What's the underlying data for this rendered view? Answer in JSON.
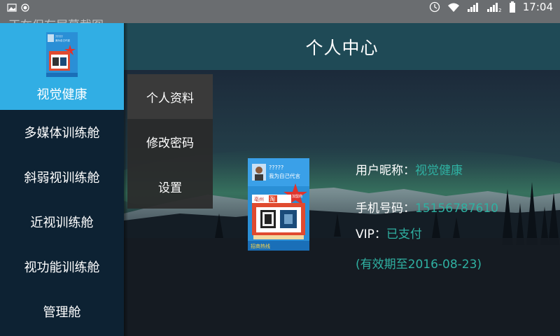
{
  "status_bar": {
    "notification": "正在保存屏幕截图",
    "time": "17:04",
    "sim_index": "2"
  },
  "sidebar": {
    "app_name": "视觉健康",
    "logo_text": {
      "qmarks": "?????",
      "tagline": "我为自己代言",
      "shop": "亳州",
      "tao": "淘",
      "star": "加盟商",
      "footer": "招商热线"
    },
    "items": [
      {
        "label": "多媒体训练舱"
      },
      {
        "label": "斜弱视训练舱"
      },
      {
        "label": "近视训练舱"
      },
      {
        "label": "视功能训练舱"
      },
      {
        "label": "管理舱"
      }
    ]
  },
  "header": {
    "title": "个人中心"
  },
  "submenu": {
    "items": [
      {
        "label": "个人资料"
      },
      {
        "label": "修改密码"
      },
      {
        "label": "设置"
      }
    ]
  },
  "profile": {
    "nickname_label": "用户昵称：",
    "nickname_value": "视觉健康",
    "phone_label": "手机号码：",
    "phone_value": "15156787610",
    "vip_label": "VIP：",
    "vip_value": "已支付",
    "validity": "(有效期至2016-08-23)"
  },
  "colors": {
    "sidebar_accent": "#31aee4",
    "sidebar_bg": "#0d2233",
    "titlebar_bg": "#1f4a56",
    "value_text": "#2fb1a2"
  },
  "icons": {
    "status_left": [
      "image-icon",
      "record-icon"
    ],
    "status_right": [
      "alarm-icon",
      "wifi-icon",
      "signal-icon",
      "signal-icon",
      "battery-icon"
    ]
  }
}
